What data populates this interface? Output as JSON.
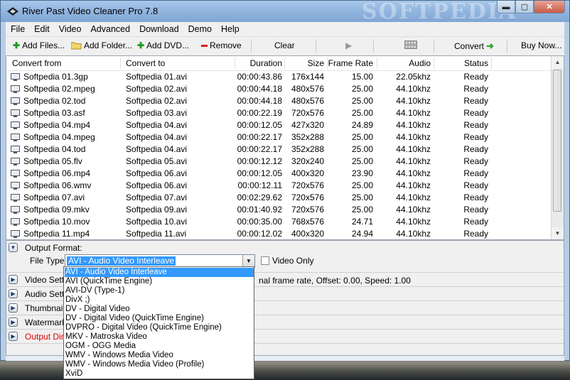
{
  "window": {
    "title": "River Past Video Cleaner Pro 7.8",
    "watermark": "SOFTPEDIA",
    "controls": {
      "minimize": "▬",
      "maximize": "▢",
      "close": "✕"
    }
  },
  "menu": [
    "File",
    "Edit",
    "Video",
    "Advanced",
    "Download",
    "Demo",
    "Help"
  ],
  "toolbar": {
    "add_files": "Add Files...",
    "add_folder": "Add Folder...",
    "add_dvd": "Add DVD...",
    "remove": "Remove",
    "clear": "Clear",
    "convert": "Convert",
    "buy_now": "Buy Now...",
    "colors": {
      "add": "#1a9a1a",
      "remove": "#d81e1e",
      "convert": "#2aa52a"
    }
  },
  "columns": [
    "Convert from",
    "Convert to",
    "Duration",
    "Size",
    "Frame Rate",
    "Audio",
    "Status"
  ],
  "rows": [
    [
      "Softpedia 01.3gp",
      "Softpedia 01.avi",
      "00:00:43.86",
      "176x144",
      "15.00",
      "22.05khz",
      "Ready"
    ],
    [
      "Softpedia 02.mpeg",
      "Softpedia 02.avi",
      "00:00:44.18",
      "480x576",
      "25.00",
      "44.10khz",
      "Ready"
    ],
    [
      "Softpedia 02.tod",
      "Softpedia 02.avi",
      "00:00:44.18",
      "480x576",
      "25.00",
      "44.10khz",
      "Ready"
    ],
    [
      "Softpedia 03.asf",
      "Softpedia 03.avi",
      "00:00:22.19",
      "720x576",
      "25.00",
      "44.10khz",
      "Ready"
    ],
    [
      "Softpedia 04.mp4",
      "Softpedia 04.avi",
      "00:00:12.05",
      "427x320",
      "24.89",
      "44.10khz",
      "Ready"
    ],
    [
      "Softpedia 04.mpeg",
      "Softpedia 04.avi",
      "00:00:22.17",
      "352x288",
      "25.00",
      "44.10khz",
      "Ready"
    ],
    [
      "Softpedia 04.tod",
      "Softpedia 04.avi",
      "00:00:22.17",
      "352x288",
      "25.00",
      "44.10khz",
      "Ready"
    ],
    [
      "Softpedia 05.flv",
      "Softpedia 05.avi",
      "00:00:12.12",
      "320x240",
      "25.00",
      "44.10khz",
      "Ready"
    ],
    [
      "Softpedia 06.mp4",
      "Softpedia 06.avi",
      "00:00:12.05",
      "400x320",
      "23.90",
      "44.10khz",
      "Ready"
    ],
    [
      "Softpedia 06.wmv",
      "Softpedia 06.avi",
      "00:00:12.11",
      "720x576",
      "25.00",
      "44.10khz",
      "Ready"
    ],
    [
      "Softpedia 07.avi",
      "Softpedia 07.avi",
      "00:02:29.62",
      "720x576",
      "25.00",
      "44.10khz",
      "Ready"
    ],
    [
      "Softpedia 09.mkv",
      "Softpedia 09.avi",
      "00:01:40.92",
      "720x576",
      "25.00",
      "44.10khz",
      "Ready"
    ],
    [
      "Softpedia 10.mov",
      "Softpedia 10.avi",
      "00:00:35.00",
      "768x576",
      "24.71",
      "44.10khz",
      "Ready"
    ],
    [
      "Softpedia 11.mp4",
      "Softpedia 11.avi",
      "00:00:12.02",
      "400x320",
      "24.94",
      "44.10khz",
      "Ready"
    ]
  ],
  "output": {
    "header": "Output Format:",
    "file_type_label": "File Type:",
    "file_type_value": "AVI - Audio Video Interleave",
    "video_only_label": "Video Only",
    "video_only_checked": false
  },
  "sections": {
    "video": "Video Settings",
    "video_info": "nal frame rate, Offset: 0.00, Speed: 1.00",
    "audio": "Audio Settings",
    "thumbnail": "Thumbnail S",
    "watermark": "Watermark",
    "output_dir": "Output Dire"
  },
  "dropdown": [
    "AVI - Audio Video Interleave",
    "AVI (QuickTime Engine)",
    "AVI-DV (Type-1)",
    "DivX ;)",
    "DV - Digital Video",
    "DV - Digital Video (QuickTime Engine)",
    "DVPRO - Digital Video (QuickTime Engine)",
    "MKV - Matroska Video",
    "OGM - OGG Media",
    "WMV - Windows Media Video",
    "WMV - Windows Media Video (Profile)",
    "XviD"
  ],
  "dropdown_selected_index": 0
}
